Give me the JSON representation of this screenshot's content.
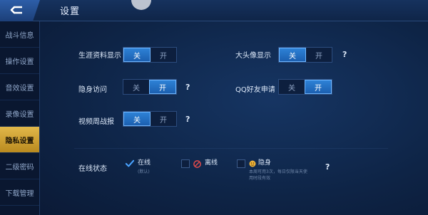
{
  "header": {
    "title": "设置"
  },
  "sidebar": {
    "items": [
      {
        "label": "战斗信息",
        "active": false
      },
      {
        "label": "操作设置",
        "active": false
      },
      {
        "label": "音效设置",
        "active": false
      },
      {
        "label": "录像设置",
        "active": false
      },
      {
        "label": "隐私设置",
        "active": true
      },
      {
        "label": "二级密码",
        "active": false
      },
      {
        "label": "下载管理",
        "active": false
      }
    ]
  },
  "settings": {
    "career": {
      "label": "生涯资料显示",
      "off": "关",
      "on": "开",
      "selected": "off"
    },
    "avatar": {
      "label": "大头像显示",
      "off": "关",
      "on": "开",
      "selected": "off",
      "help": "?"
    },
    "hidden_visit": {
      "label": "隐身访问",
      "off": "关",
      "on": "开",
      "selected": "on",
      "help": "?"
    },
    "qq_friend": {
      "label": "QQ好友申请",
      "off": "关",
      "on": "开",
      "selected": "on"
    },
    "video_report": {
      "label": "视频周战报",
      "off": "关",
      "on": "开",
      "selected": "off",
      "help": "?"
    }
  },
  "online_status": {
    "label": "在线状态",
    "options": [
      {
        "label": "在线",
        "sub": "(默认)",
        "checked": true
      },
      {
        "label": "离线",
        "sub": "",
        "checked": false
      },
      {
        "label": "隐身",
        "sub": "本周可用3次，每日仅限当天使用时段有效",
        "checked": false
      }
    ],
    "help": "?"
  },
  "colors": {
    "accent": "#2e82d6",
    "active_tab": "#e2b84a",
    "background": "#0b1a36"
  }
}
